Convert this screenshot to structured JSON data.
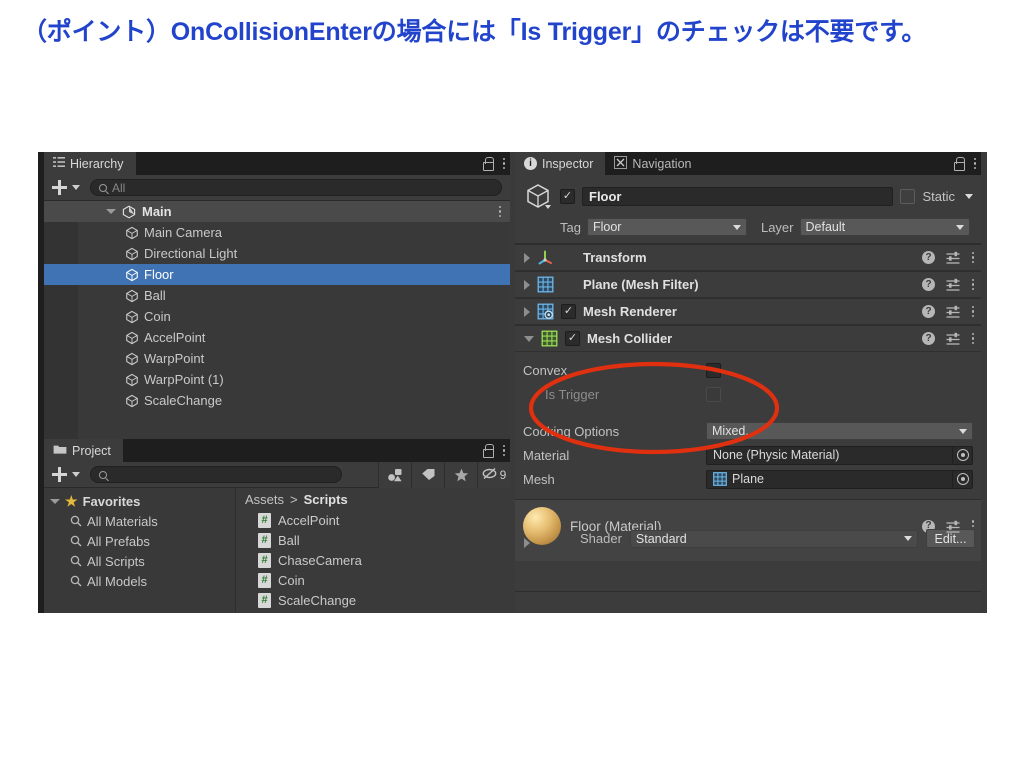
{
  "slide": {
    "heading": "（ポイント）OnCollisionEnterの場合には「Is Trigger」のチェックは不要です。",
    "heading_color": "#2244cc"
  },
  "annotation": {
    "shape": "ellipse",
    "color": "#e03010",
    "encircles": [
      "Convex",
      "Is Trigger"
    ]
  },
  "hierarchy": {
    "tab_label": "Hierarchy",
    "tab_icon": "hierarchy-icon",
    "lock_icon": "lock-icon",
    "menu_icon": "kebab-menu-icon",
    "add_button": "+",
    "search_placeholder": "All",
    "search_value": "",
    "root": {
      "label": "Main",
      "icon": "unity-scene-icon",
      "expanded": true
    },
    "items": [
      {
        "label": "Main Camera",
        "icon": "cube-icon",
        "selected": false
      },
      {
        "label": "Directional Light",
        "icon": "cube-icon",
        "selected": false
      },
      {
        "label": "Floor",
        "icon": "cube-icon",
        "selected": true
      },
      {
        "label": "Ball",
        "icon": "cube-icon",
        "selected": false
      },
      {
        "label": "Coin",
        "icon": "cube-icon",
        "selected": false
      },
      {
        "label": "AccelPoint",
        "icon": "cube-icon",
        "selected": false
      },
      {
        "label": "WarpPoint",
        "icon": "cube-icon",
        "selected": false
      },
      {
        "label": "WarpPoint (1)",
        "icon": "cube-icon",
        "selected": false
      },
      {
        "label": "ScaleChange",
        "icon": "cube-icon",
        "selected": false
      }
    ],
    "selection_color": "#4073b3"
  },
  "project": {
    "tab_label": "Project",
    "tab_icon": "folder-icon",
    "add_button": "+",
    "search_placeholder": "",
    "toolbar_buttons": [
      {
        "icon": "asset-filter-icon",
        "label": ""
      },
      {
        "icon": "label-tag-icon",
        "label": ""
      },
      {
        "icon": "star-icon",
        "label": ""
      },
      {
        "icon": "hidden-eye-icon",
        "label": "9"
      }
    ],
    "tree": [
      {
        "label": "Favorites",
        "icon": "star-icon",
        "expanded": true,
        "depth": 0
      },
      {
        "label": "All Materials",
        "icon": "search-icon",
        "depth": 1
      },
      {
        "label": "All Prefabs",
        "icon": "search-icon",
        "depth": 1
      },
      {
        "label": "All Scripts",
        "icon": "search-icon",
        "depth": 1
      },
      {
        "label": "All Models",
        "icon": "search-icon",
        "depth": 1
      }
    ],
    "breadcrumb": {
      "root": "Assets",
      "separator": ">",
      "current": "Scripts"
    },
    "assets": [
      {
        "label": "AccelPoint",
        "icon": "csharp-script-icon"
      },
      {
        "label": "Ball",
        "icon": "csharp-script-icon"
      },
      {
        "label": "ChaseCamera",
        "icon": "csharp-script-icon"
      },
      {
        "label": "Coin",
        "icon": "csharp-script-icon"
      },
      {
        "label": "ScaleChange",
        "icon": "csharp-script-icon"
      }
    ]
  },
  "inspector": {
    "tabs": [
      {
        "label": "Inspector",
        "icon": "info-icon",
        "active": true
      },
      {
        "label": "Navigation",
        "icon": "navigation-icon",
        "active": false
      }
    ],
    "lock_icon": "lock-icon",
    "menu_icon": "kebab-menu-icon",
    "gameobject": {
      "icon": "cube-icon",
      "enabled": true,
      "name": "Floor",
      "static_checked": false,
      "static_label": "Static",
      "tag_label": "Tag",
      "tag_value": "Floor",
      "layer_label": "Layer",
      "layer_value": "Default"
    },
    "components": [
      {
        "name": "Transform",
        "icon": "transform-gizmo-icon",
        "expanded": false,
        "has_toggle": false
      },
      {
        "name": "Plane (Mesh Filter)",
        "icon": "mesh-filter-icon",
        "expanded": false,
        "has_toggle": false
      },
      {
        "name": "Mesh Renderer",
        "icon": "mesh-renderer-icon",
        "expanded": false,
        "has_toggle": true,
        "enabled": true
      },
      {
        "name": "Mesh Collider",
        "icon": "mesh-collider-icon",
        "expanded": true,
        "has_toggle": true,
        "enabled": true
      }
    ],
    "mesh_collider": {
      "convex": {
        "label": "Convex",
        "checked": false
      },
      "is_trigger": {
        "label": "Is Trigger",
        "checked": false,
        "disabled": true
      },
      "cooking_options": {
        "label": "Cooking Options",
        "value": "Mixed..."
      },
      "material": {
        "label": "Material",
        "value": "None (Physic Material)"
      },
      "mesh": {
        "label": "Mesh",
        "value": "Plane",
        "icon": "mesh-filter-icon"
      }
    },
    "material_preview": {
      "title": "Floor (Material)",
      "shader_label": "Shader",
      "shader_value": "Standard",
      "edit_button": "Edit...",
      "help_icon": "help-icon",
      "preset_icon": "preset-icon",
      "menu_icon": "kebab-menu-icon"
    },
    "row_icons": {
      "help": "help-icon",
      "preset": "preset-icon",
      "menu": "kebab-menu-icon"
    }
  }
}
